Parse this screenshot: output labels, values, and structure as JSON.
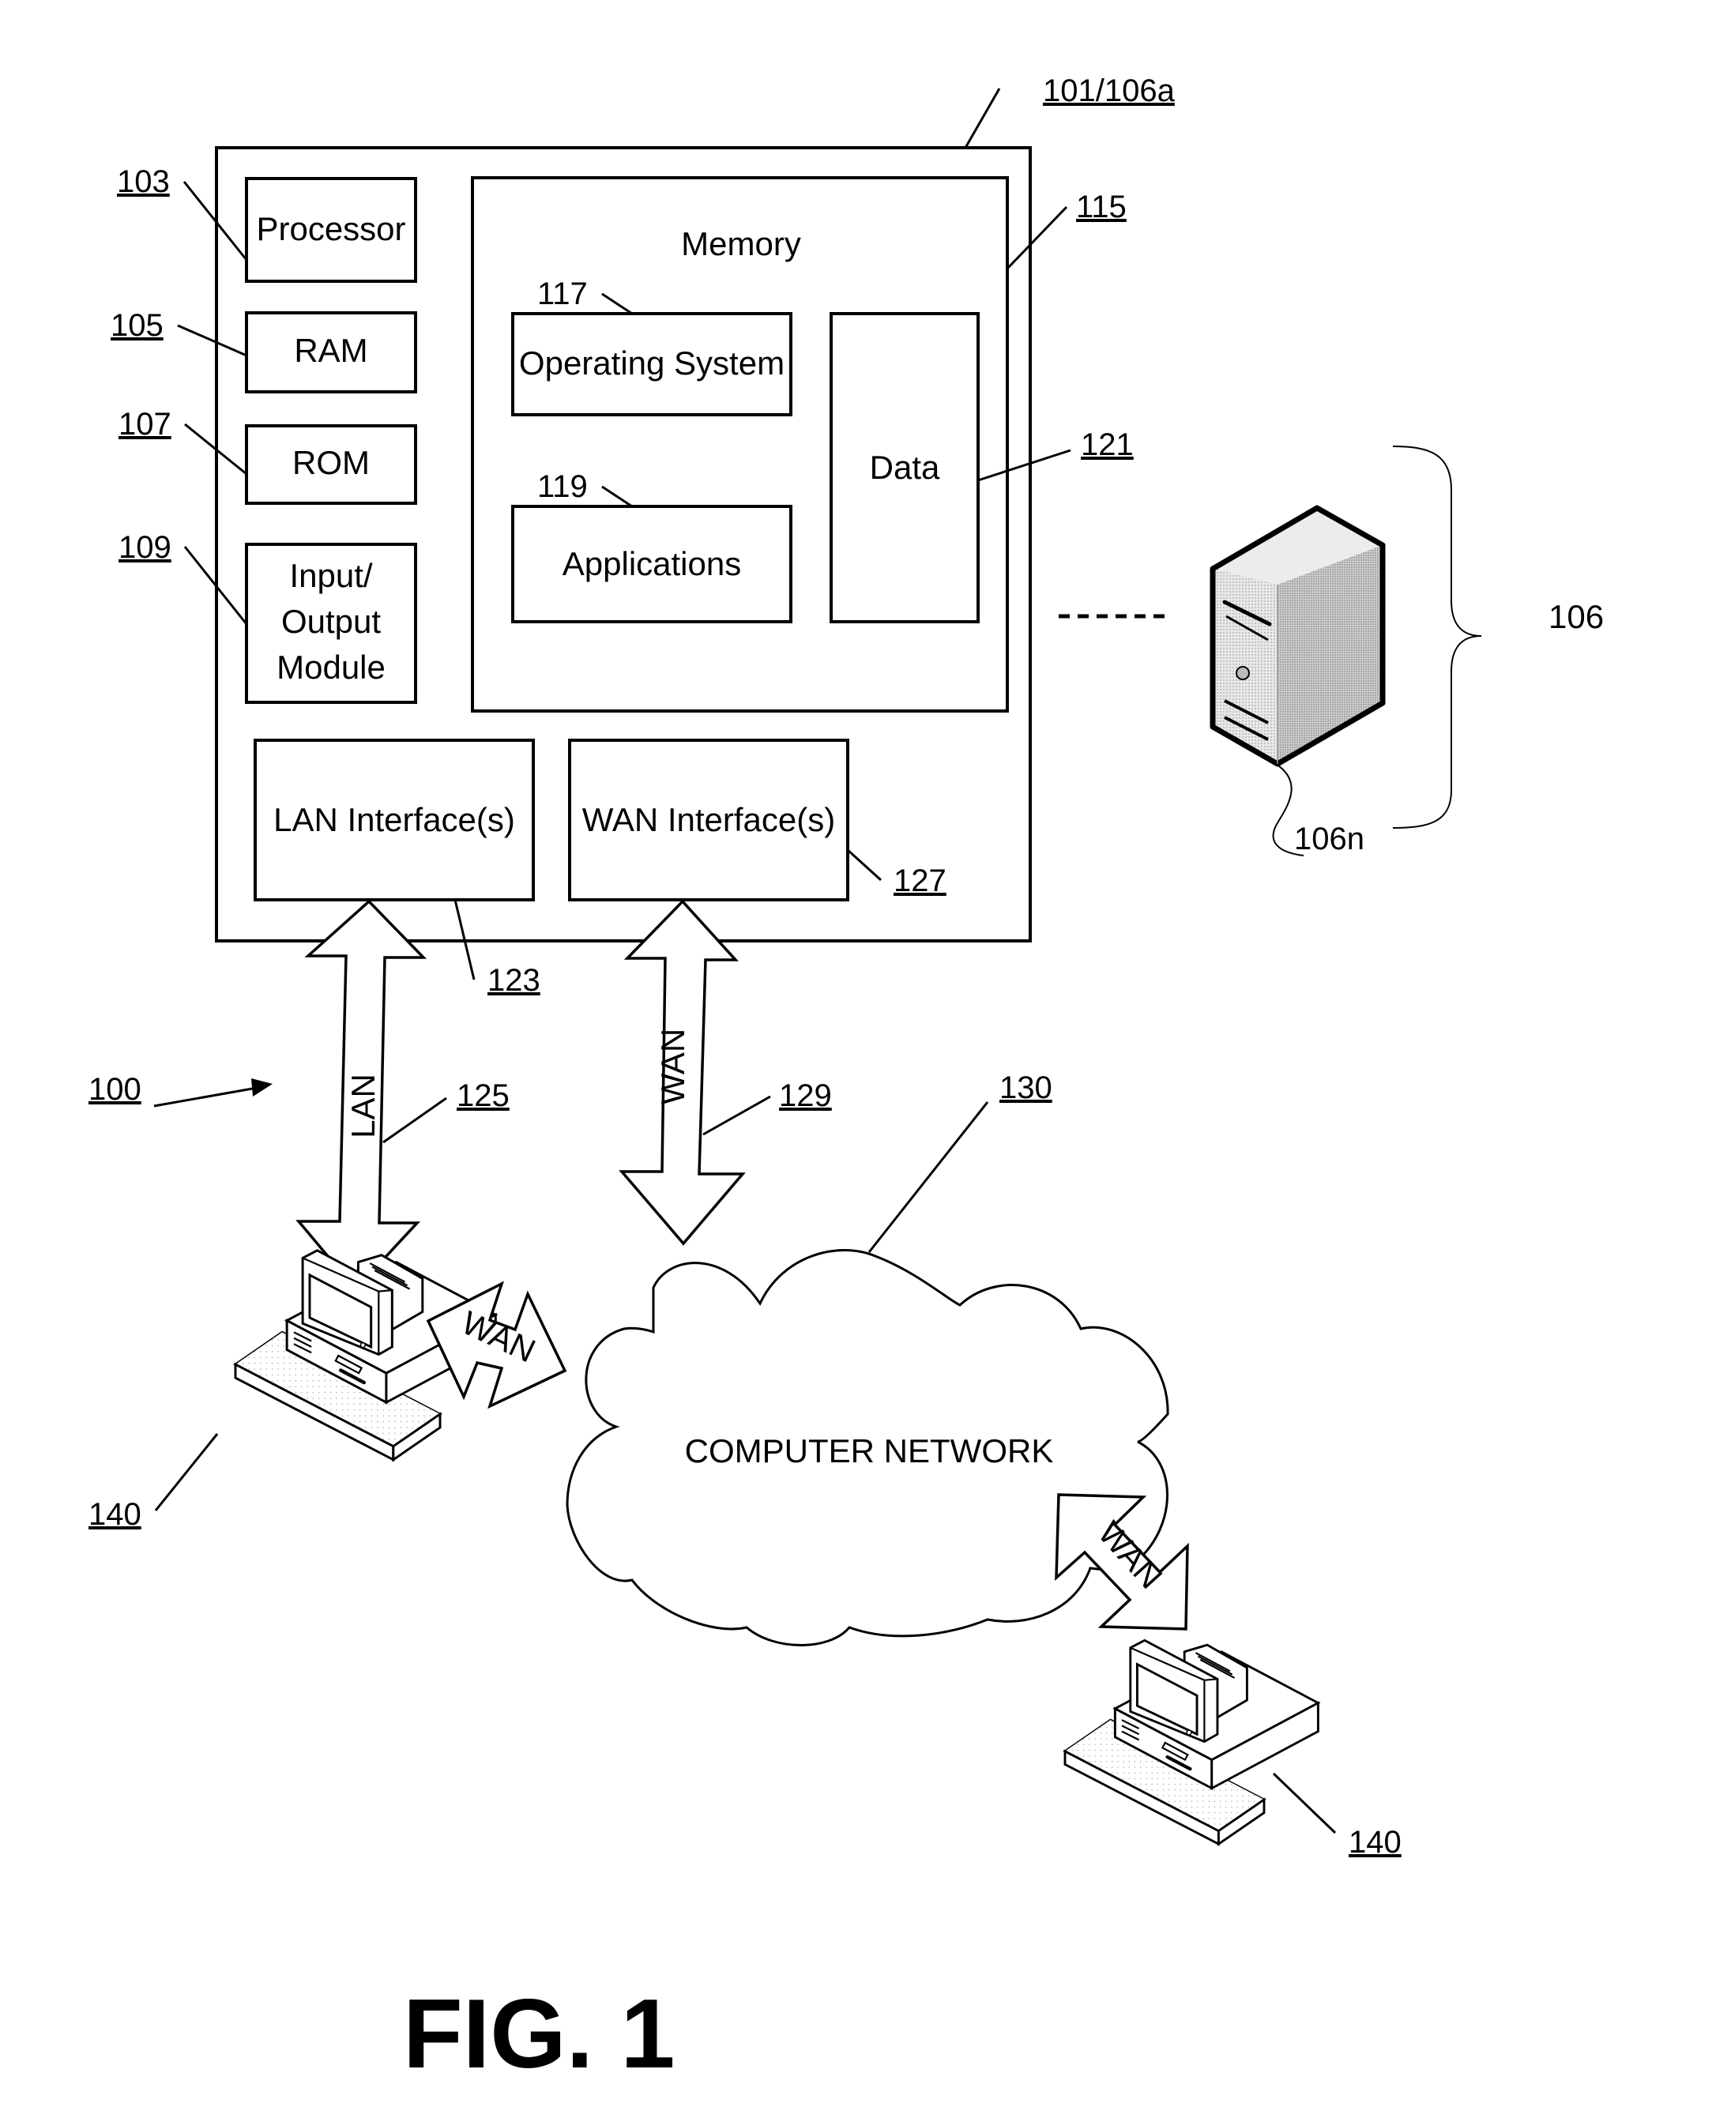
{
  "figure": {
    "caption": "FIG. 1",
    "system_ref": "100"
  },
  "device": {
    "ref": "101/106a",
    "components": {
      "processor": {
        "label": "Processor",
        "ref": "103"
      },
      "ram": {
        "label": "RAM",
        "ref": "105"
      },
      "rom": {
        "label": "ROM",
        "ref": "107"
      },
      "io": {
        "label_lines": [
          "Input/",
          "Output",
          "Module"
        ],
        "ref": "109"
      },
      "memory": {
        "label": "Memory",
        "ref": "115",
        "os": {
          "label": "Operating System",
          "ref": "117"
        },
        "apps": {
          "label": "Applications",
          "ref": "119"
        },
        "data": {
          "label": "Data",
          "ref": "121"
        }
      },
      "lan_interface": {
        "label": "LAN Interface(s)",
        "ref": "123"
      },
      "wan_interface": {
        "label": "WAN Interface(s)",
        "ref": "127"
      }
    }
  },
  "servers": {
    "group_ref": "106",
    "server_ref": "106n",
    "icon": "server-tower-icon"
  },
  "links": {
    "lan": {
      "label": "LAN",
      "ref": "125"
    },
    "wan": {
      "label": "WAN",
      "ref": "129"
    },
    "terminal_wan": {
      "label": "WAN"
    },
    "remote_wan": {
      "label": "WAN"
    }
  },
  "network": {
    "label": "COMPUTER NETWORK",
    "ref": "130"
  },
  "terminals": [
    {
      "ref": "140",
      "icon": "desktop-computer-icon"
    },
    {
      "ref": "140",
      "icon": "desktop-computer-icon"
    }
  ]
}
